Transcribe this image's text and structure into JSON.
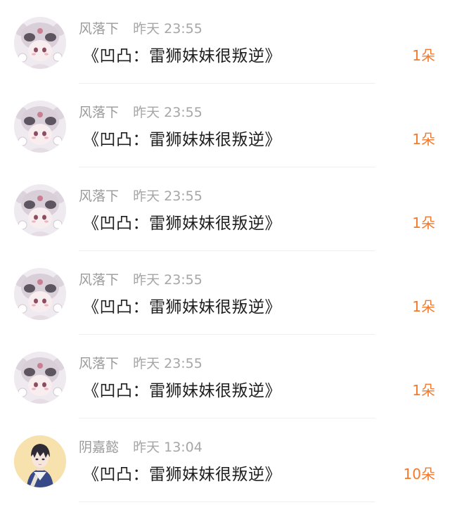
{
  "items": [
    {
      "username": "风落下",
      "time": "昨天 23:55",
      "title": "《凹凸：雷狮妹妹很叛逆》",
      "gift": "1朵",
      "avatar": "anime-girl-hood-avatar"
    },
    {
      "username": "风落下",
      "time": "昨天 23:55",
      "title": "《凹凸：雷狮妹妹很叛逆》",
      "gift": "1朵",
      "avatar": "anime-girl-hood-avatar"
    },
    {
      "username": "风落下",
      "time": "昨天 23:55",
      "title": "《凹凸：雷狮妹妹很叛逆》",
      "gift": "1朵",
      "avatar": "anime-girl-hood-avatar"
    },
    {
      "username": "风落下",
      "time": "昨天 23:55",
      "title": "《凹凸：雷狮妹妹很叛逆》",
      "gift": "1朵",
      "avatar": "anime-girl-hood-avatar"
    },
    {
      "username": "风落下",
      "time": "昨天 23:55",
      "title": "《凹凸：雷狮妹妹很叛逆》",
      "gift": "1朵",
      "avatar": "anime-girl-hood-avatar"
    },
    {
      "username": "阴嘉懿",
      "time": "昨天 13:04",
      "title": "《凹凸：雷狮妹妹很叛逆》",
      "gift": "10朵",
      "avatar": "anime-boy-avatar"
    }
  ],
  "colors": {
    "gift_accent": "#f37a2c",
    "meta_text": "#9b9b9b",
    "title_text": "#1f1f1f",
    "divider": "#efefef"
  }
}
